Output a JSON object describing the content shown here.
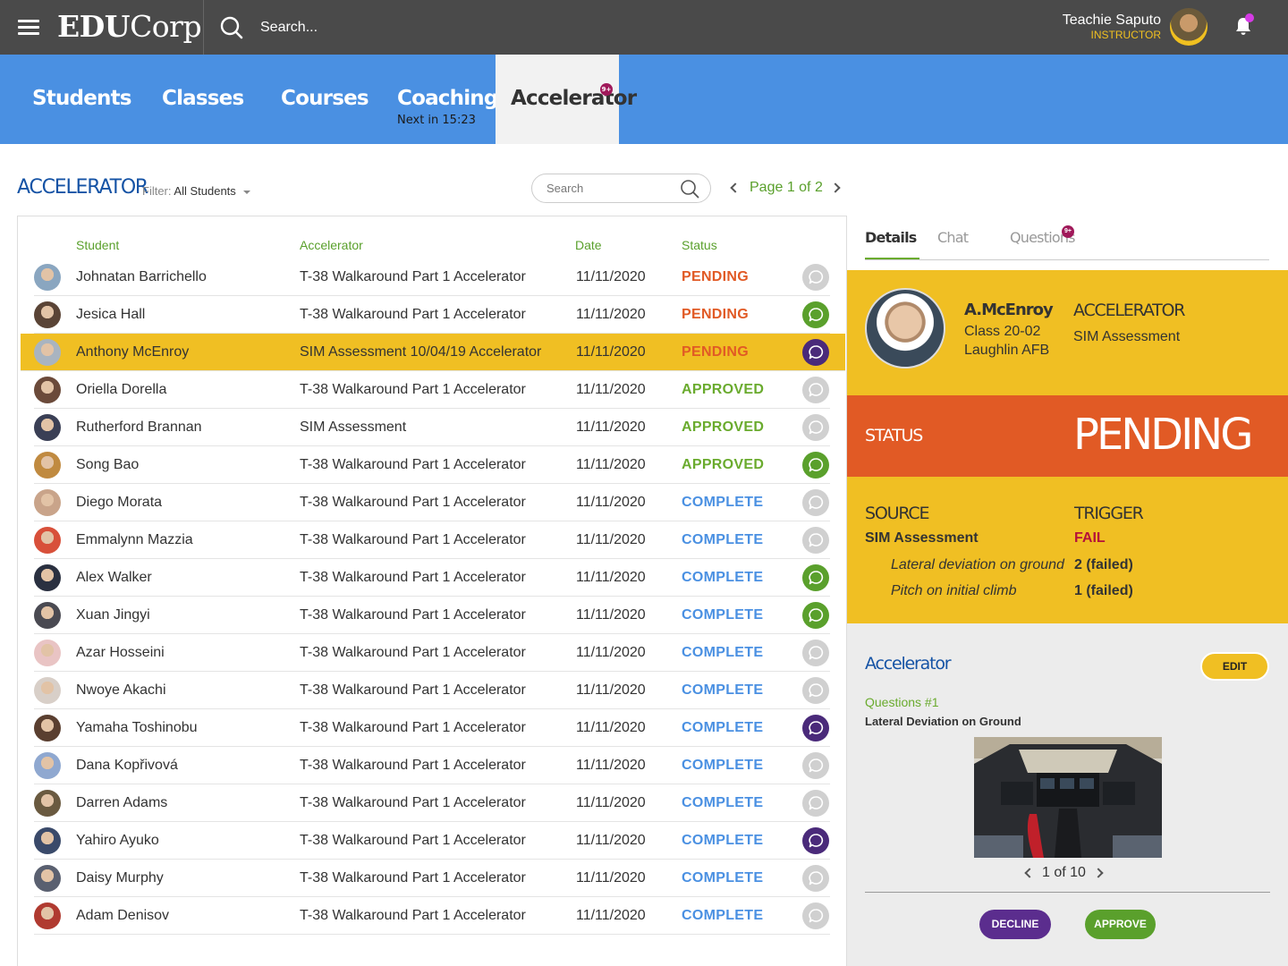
{
  "header": {
    "logo_bold": "EDU",
    "logo_rest": "Corp",
    "search_placeholder": "Search...",
    "user_name": "Teachie Saputo",
    "user_role": "INSTRUCTOR"
  },
  "nav": {
    "tabs": [
      {
        "label": "Students"
      },
      {
        "label": "Classes"
      },
      {
        "label": "Courses"
      },
      {
        "label": "Coaching",
        "sub": "Next in 15:23"
      },
      {
        "label": "Accelerator",
        "badge": "9+",
        "active": true
      }
    ]
  },
  "page": {
    "title": "ACCELERATOR",
    "filter_label": "Filter:",
    "filter_value": "All Students",
    "search_placeholder": "Search",
    "pager": "Page 1 of 2"
  },
  "table": {
    "columns": [
      "Student",
      "Accelerator",
      "Date",
      "Status"
    ],
    "rows": [
      {
        "name": "Johnatan Barrichello",
        "accelerator": "T-38 Walkaround Part 1 Accelerator",
        "date": "11/11/2020",
        "status": "PENDING",
        "chat": "none",
        "avatar": "#8aa6c0"
      },
      {
        "name": "Jesica Hall",
        "accelerator": "T-38 Walkaround Part 1 Accelerator",
        "date": "11/11/2020",
        "status": "PENDING",
        "chat": "green",
        "avatar": "#5a4436"
      },
      {
        "name": "Anthony McEnroy",
        "accelerator": "SIM Assessment 10/04/19 Accelerator",
        "date": "11/11/2020",
        "status": "PENDING",
        "chat": "purple",
        "avatar": "#a9b4c0",
        "selected": true
      },
      {
        "name": "Oriella Dorella",
        "accelerator": "T-38 Walkaround Part 1 Accelerator",
        "date": "11/11/2020",
        "status": "APPROVED",
        "chat": "none",
        "avatar": "#6b4a3a"
      },
      {
        "name": "Rutherford Brannan",
        "accelerator": "SIM Assessment",
        "date": "11/11/2020",
        "status": "APPROVED",
        "chat": "none",
        "avatar": "#3a3f55"
      },
      {
        "name": "Song Bao",
        "accelerator": "T-38 Walkaround Part 1 Accelerator",
        "date": "11/11/2020",
        "status": "APPROVED",
        "chat": "green",
        "avatar": "#c08a40"
      },
      {
        "name": "Diego Morata",
        "accelerator": "T-38 Walkaround Part 1 Accelerator",
        "date": "11/11/2020",
        "status": "COMPLETE",
        "chat": "none",
        "avatar": "#c9a48a"
      },
      {
        "name": "Emmalynn Mazzia",
        "accelerator": "T-38 Walkaround Part 1 Accelerator",
        "date": "11/11/2020",
        "status": "COMPLETE",
        "chat": "none",
        "avatar": "#d8503a"
      },
      {
        "name": "Alex Walker",
        "accelerator": "T-38 Walkaround Part 1 Accelerator",
        "date": "11/11/2020",
        "status": "COMPLETE",
        "chat": "green",
        "avatar": "#2a3040"
      },
      {
        "name": "Xuan Jingyi",
        "accelerator": "T-38 Walkaround Part 1 Accelerator",
        "date": "11/11/2020",
        "status": "COMPLETE",
        "chat": "green",
        "avatar": "#4a4a52"
      },
      {
        "name": "Azar Hosseini",
        "accelerator": "T-38 Walkaround Part 1 Accelerator",
        "date": "11/11/2020",
        "status": "COMPLETE",
        "chat": "none",
        "avatar": "#e9c4c4"
      },
      {
        "name": "Nwoye Akachi",
        "accelerator": "T-38 Walkaround Part 1 Accelerator",
        "date": "11/11/2020",
        "status": "COMPLETE",
        "chat": "none",
        "avatar": "#d8cfc8"
      },
      {
        "name": "Yamaha Toshinobu",
        "accelerator": "T-38 Walkaround Part 1 Accelerator",
        "date": "11/11/2020",
        "status": "COMPLETE",
        "chat": "purple",
        "avatar": "#5a3f30"
      },
      {
        "name": "Dana Kopřivová",
        "accelerator": "T-38 Walkaround Part 1 Accelerator",
        "date": "11/11/2020",
        "status": "COMPLETE",
        "chat": "none",
        "avatar": "#8fa8d0"
      },
      {
        "name": "Darren Adams",
        "accelerator": "T-38 Walkaround Part 1 Accelerator",
        "date": "11/11/2020",
        "status": "COMPLETE",
        "chat": "none",
        "avatar": "#6a5a40"
      },
      {
        "name": "Yahiro Ayuko",
        "accelerator": "T-38 Walkaround Part 1 Accelerator",
        "date": "11/11/2020",
        "status": "COMPLETE",
        "chat": "purple",
        "avatar": "#3a4a6a"
      },
      {
        "name": "Daisy Murphy",
        "accelerator": "T-38 Walkaround Part 1 Accelerator",
        "date": "11/11/2020",
        "status": "COMPLETE",
        "chat": "none",
        "avatar": "#5a6070"
      },
      {
        "name": "Adam Denisov",
        "accelerator": "T-38 Walkaround Part 1 Accelerator",
        "date": "11/11/2020",
        "status": "COMPLETE",
        "chat": "none",
        "avatar": "#b03a30"
      }
    ]
  },
  "details": {
    "tabs": [
      {
        "label": "Details",
        "active": true
      },
      {
        "label": "Chat"
      },
      {
        "label": "Questions",
        "badge": "9+"
      }
    ],
    "student_name": "A.McEnroy",
    "student_class": "Class 20-02",
    "student_base": "Laughlin AFB",
    "accelerator_heading": "ACCELERATOR",
    "accelerator_value": "SIM Assessment",
    "status_label": "STATUS",
    "status_value": "PENDING",
    "source_heading": "SOURCE",
    "source_value": "SIM Assessment",
    "trigger_heading": "TRIGGER",
    "trigger_value": "FAIL",
    "items": [
      {
        "label": "Lateral deviation on ground",
        "count": "2 (failed)"
      },
      {
        "label": "Pitch on initial climb",
        "count": "1 (failed)"
      }
    ],
    "accelerator_section_title": "Accelerator",
    "edit_label": "EDIT",
    "question_number": "Questions #1",
    "question_title": "Lateral Deviation on Ground",
    "image_pager": "1 of 10",
    "decline_label": "DECLINE",
    "approve_label": "APPROVE"
  },
  "colors": {
    "topbar": "#4a4a4a",
    "nav": "#4a90e2",
    "accent_yellow": "#f0bf23",
    "status_orange": "#e15a25",
    "brand_blue": "#1553a5",
    "green": "#5aa02c",
    "purple": "#5b2d8e"
  }
}
